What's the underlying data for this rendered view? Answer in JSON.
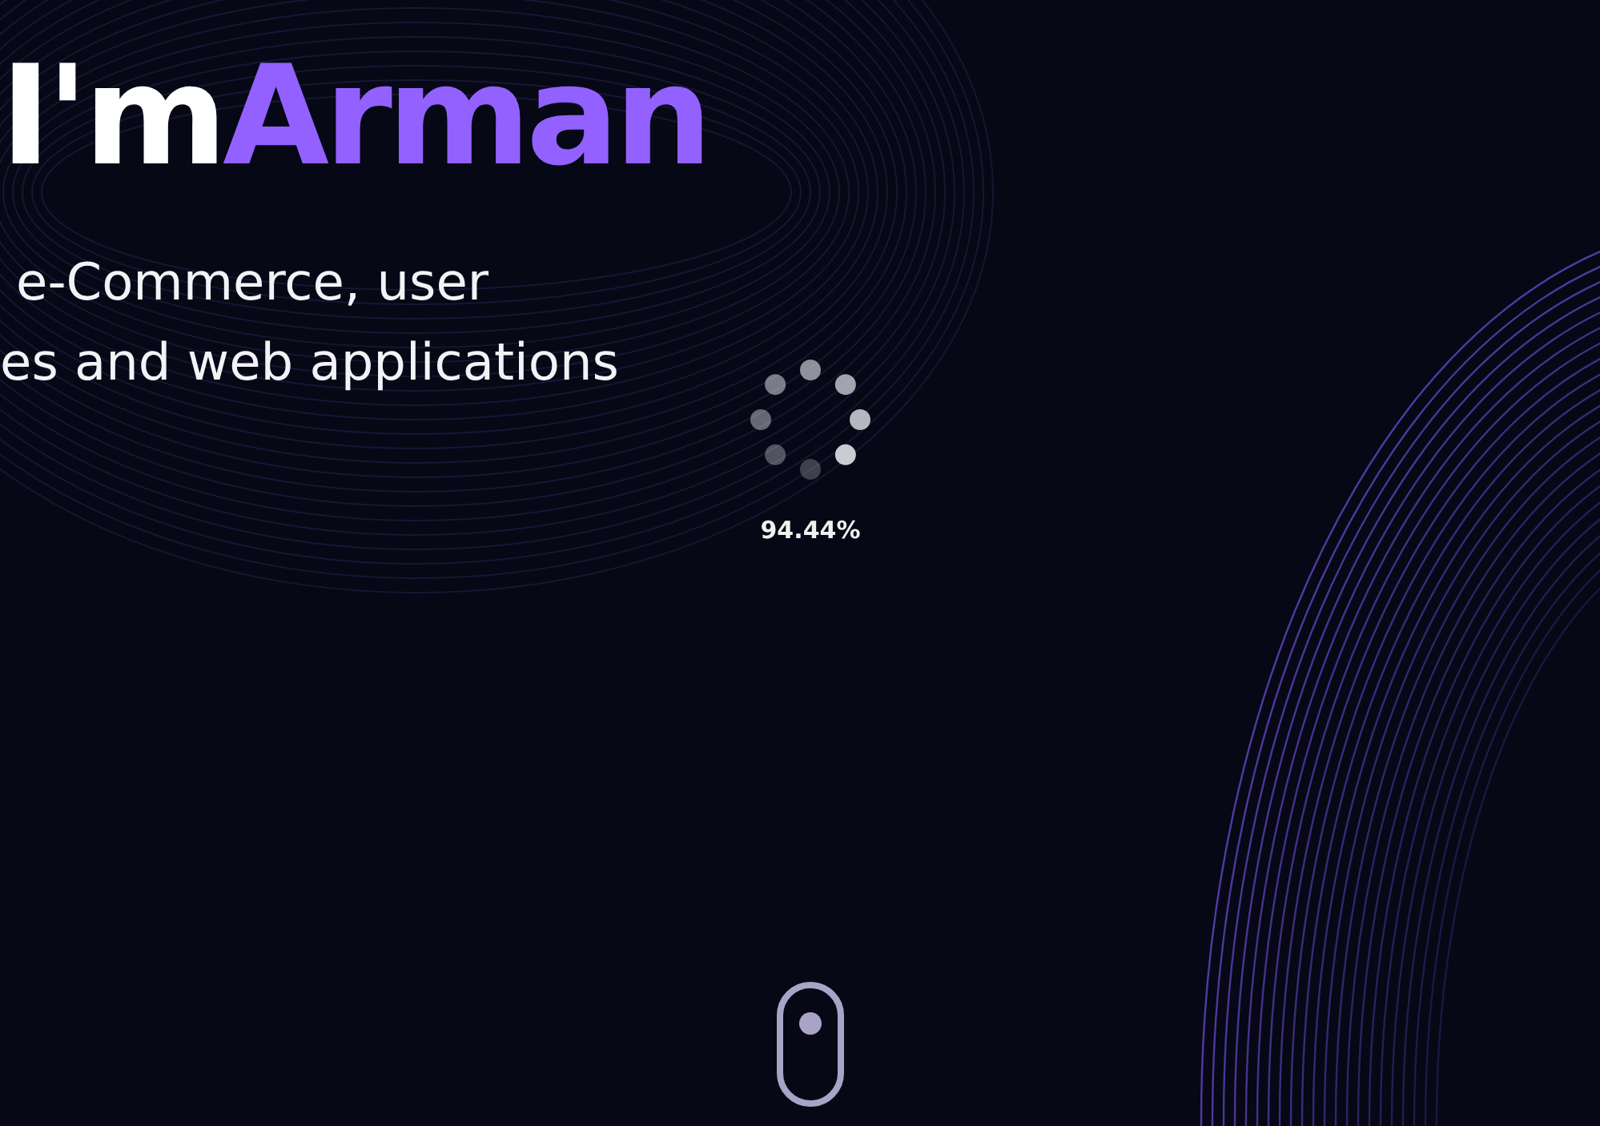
{
  "hero": {
    "greeting": "I'm",
    "name": "Arman",
    "subtitle_lines": [
      "e-Commerce, user",
      "es and web applications"
    ]
  },
  "loader": {
    "percent": "94.44%"
  }
}
